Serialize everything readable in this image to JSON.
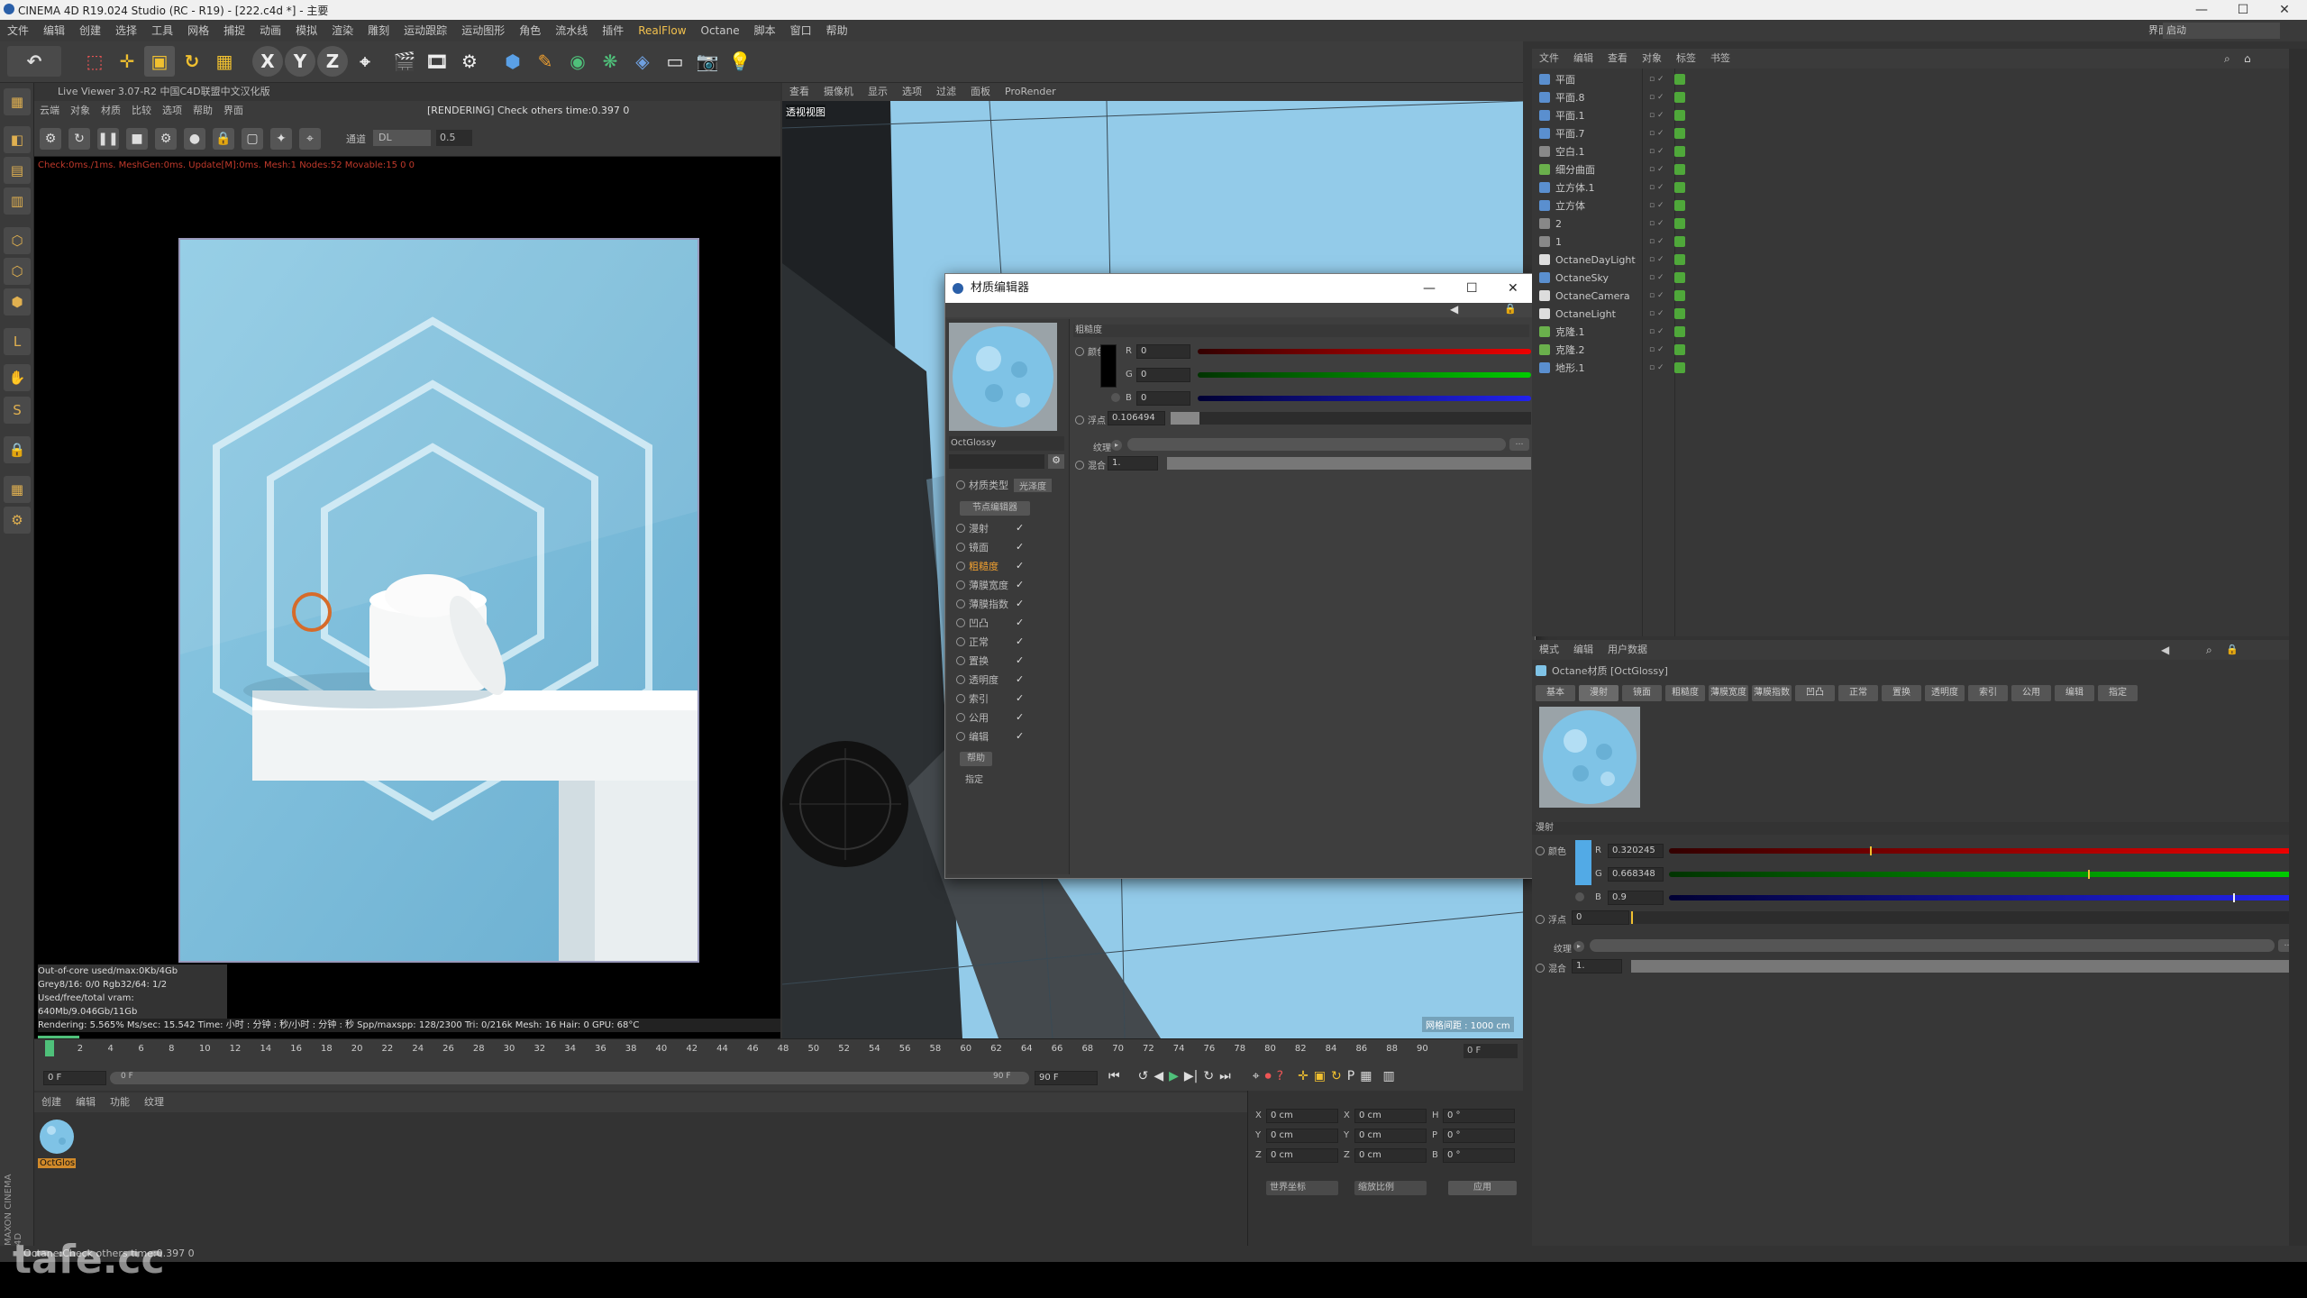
{
  "window": {
    "title": "CINEMA 4D R19.024 Studio (RC - R19) - [222.c4d *] - 主要",
    "buttons": [
      "—",
      "☐",
      "✕"
    ],
    "layout_label": "界面",
    "layout_value": "启动"
  },
  "menubar": [
    "文件",
    "编辑",
    "创建",
    "选择",
    "工具",
    "网格",
    "捕捉",
    "动画",
    "模拟",
    "渲染",
    "雕刻",
    "运动跟踪",
    "运动图形",
    "角色",
    "流水线",
    "插件",
    "RealFlow",
    "Octane",
    "脚本",
    "窗口",
    "帮助"
  ],
  "live_viewer": {
    "title": "Live Viewer 3.07-R2 中国C4D联盟中文汉化版",
    "menu": [
      "云端",
      "对象",
      "材质",
      "比较",
      "选项",
      "帮助",
      "界面"
    ],
    "render_status": "[RENDERING] Check others time:0.397  0",
    "channel_label": "通道",
    "channel_value": "DL",
    "channel_number": "0.5",
    "check_line": "Check:0ms./1ms. MeshGen:0ms. Update[M]:0ms. Mesh:1 Nodes:52 Movable:15  0 0",
    "stats": [
      "Out-of-core used/max:0Kb/4Gb",
      "Grey8/16: 0/0          Rgb32/64: 1/2",
      "Used/free/total vram: 640Mb/9.046Gb/11Gb",
      "Rendering: 5.565% Ms/sec: 15.542   Time: 小时 : 分钟 : 秒/小时 : 分钟 : 秒   Spp/maxspp: 128/2300    Tri: 0/216k     Mesh: 16    Hair: 0     GPU:  68°C"
    ]
  },
  "viewport": {
    "menu": [
      "查看",
      "摄像机",
      "显示",
      "选项",
      "过滤",
      "面板",
      "ProRender"
    ],
    "label": "透视视图",
    "grid_info": "网格间距 : 1000 cm"
  },
  "material_editor": {
    "title": "材质编辑器",
    "material_name": "OctGlossy",
    "section": "粗糙度",
    "color_label": "颜色",
    "r_label": "R",
    "r_value": "0",
    "g_label": "G",
    "g_value": "0",
    "b_label": "B",
    "b_value": "0",
    "float_label": "浮点",
    "float_value": "0.106494",
    "texture_label": "纹理",
    "mix_label": "混合",
    "mix_value": "1.",
    "type_label": "材质类型",
    "type_value": "光泽度",
    "node_editor": "节点编辑器",
    "channels": [
      "漫射",
      "镜面",
      "粗糙度",
      "薄膜宽度",
      "薄膜指数",
      "凹凸",
      "正常",
      "置换",
      "透明度",
      "索引",
      "公用",
      "编辑"
    ],
    "active_channel": "粗糙度",
    "help_btn": "帮助",
    "assign": "指定"
  },
  "timeline": {
    "ticks": [
      "0",
      "2",
      "4",
      "6",
      "8",
      "10",
      "12",
      "14",
      "16",
      "18",
      "20",
      "22",
      "24",
      "26",
      "28",
      "30",
      "32",
      "34",
      "36",
      "38",
      "40",
      "42",
      "44",
      "46",
      "48",
      "50",
      "52",
      "54",
      "56",
      "58",
      "60",
      "62",
      "64",
      "66",
      "68",
      "70",
      "72",
      "74",
      "76",
      "78",
      "80",
      "82",
      "84",
      "86",
      "88",
      "90"
    ],
    "current_frame": "0 F",
    "start_frame": "0 F",
    "min_frame": "0 F",
    "max_frame": "90 F",
    "end_frame": "90 F"
  },
  "material_manager": {
    "menu": [
      "创建",
      "编辑",
      "功能",
      "纹理"
    ],
    "material_label": "OctGlos"
  },
  "coords": {
    "rows": [
      {
        "a": "X",
        "av": "0 cm",
        "b": "X",
        "bv": "0 cm",
        "c": "H",
        "cv": "0 °"
      },
      {
        "a": "Y",
        "av": "0 cm",
        "b": "Y",
        "bv": "0 cm",
        "c": "P",
        "cv": "0 °"
      },
      {
        "a": "Z",
        "av": "0 cm",
        "b": "Z",
        "bv": "0 cm",
        "c": "B",
        "cv": "0 °"
      }
    ],
    "dropdown1": "世界坐标",
    "dropdown2": "缩放比例",
    "apply": "应用"
  },
  "object_manager": {
    "menu": [
      "文件",
      "编辑",
      "查看",
      "对象",
      "标签",
      "书签"
    ],
    "objects": [
      {
        "name": "平面",
        "color": "#5a8fcf"
      },
      {
        "name": "平面.8",
        "color": "#5a8fcf"
      },
      {
        "name": "平面.1",
        "color": "#5a8fcf"
      },
      {
        "name": "平面.7",
        "color": "#5a8fcf"
      },
      {
        "name": "空白.1",
        "color": "#888888"
      },
      {
        "name": "细分曲面",
        "color": "#6ab04c"
      },
      {
        "name": "立方体.1",
        "color": "#5a8fcf"
      },
      {
        "name": "立方体",
        "color": "#5a8fcf"
      },
      {
        "name": "2",
        "color": "#888888"
      },
      {
        "name": "1",
        "color": "#888888"
      },
      {
        "name": "OctaneDayLight",
        "color": "#dddddd"
      },
      {
        "name": "OctaneSky",
        "color": "#5a8fcf"
      },
      {
        "name": "OctaneCamera",
        "color": "#dddddd"
      },
      {
        "name": "OctaneLight",
        "color": "#dddddd"
      },
      {
        "name": "克隆.1",
        "color": "#6ab04c"
      },
      {
        "name": "克隆.2",
        "color": "#6ab04c"
      },
      {
        "name": "地形.1",
        "color": "#5a8fcf"
      }
    ]
  },
  "attribute_manager": {
    "menu": [
      "模式",
      "编辑",
      "用户数据"
    ],
    "header": "Octane材质 [OctGlossy]",
    "tabs": [
      "基本",
      "漫射",
      "镜面",
      "粗糙度",
      "薄膜宽度",
      "薄膜指数",
      "凹凸",
      "正常",
      "置换",
      "透明度",
      "索引",
      "公用",
      "编辑",
      "指定"
    ],
    "active_tab": "漫射",
    "section": "漫射",
    "color_label": "颜色",
    "r_label": "R",
    "r_value": "0.320245",
    "g_label": "G",
    "g_value": "0.668348",
    "b_label": "B",
    "b_value": "0.9",
    "r_level": 0.32,
    "g_level": 0.668,
    "b_level": 0.9,
    "float_label": "浮点",
    "float_value": "0",
    "texture_label": "纹理",
    "mix_label": "混合",
    "mix_value": "1."
  },
  "status_bar": "Octane:Check others time:0.397  0",
  "watermark": "tafe.cc",
  "maxon_label": "MAXON CINEMA 4D"
}
